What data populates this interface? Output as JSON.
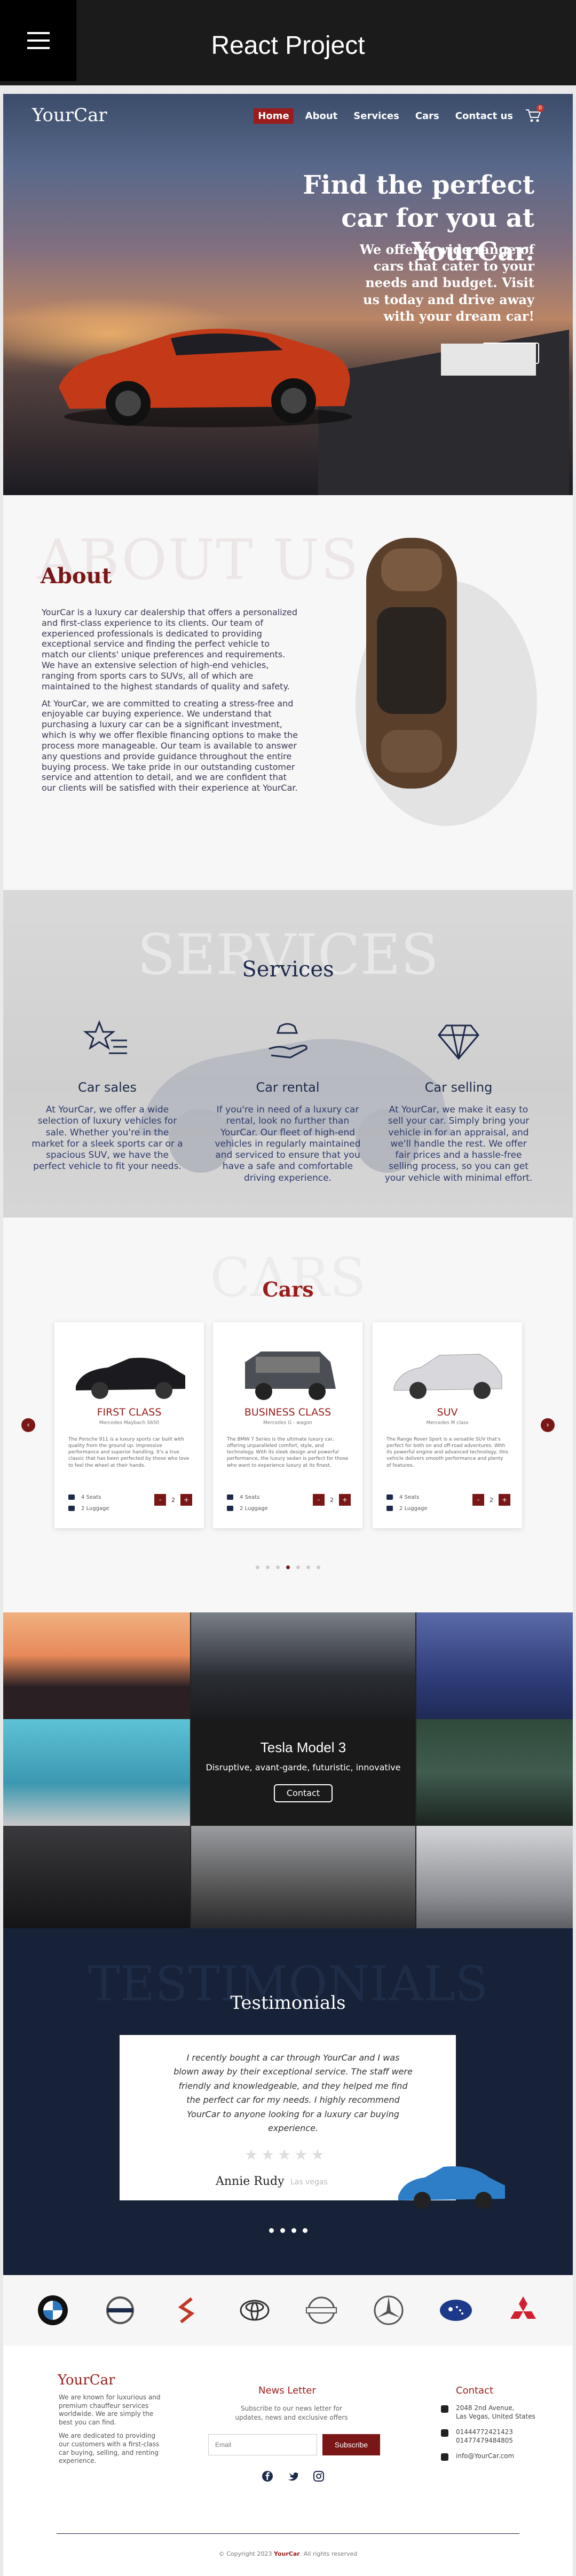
{
  "appbar": {
    "title": "React Project"
  },
  "nav": {
    "logo": "YourCar",
    "links": [
      "Home",
      "About",
      "Services",
      "Cars",
      "Contact us"
    ],
    "cart_count": "0"
  },
  "hero": {
    "heading": "Find the perfect car for you at YourCar.",
    "text": "We offer a wide range of cars that cater to your needs and budget. Visit us today and drive away with your dream car!"
  },
  "about": {
    "ghost": "ABOUT US",
    "title": "About",
    "p1": "YourCar is a luxury car dealership that offers a personalized and first-class experience to its clients. Our team of experienced professionals is dedicated to providing exceptional service and finding the perfect vehicle to match our clients' unique preferences and requirements. We have an extensive selection of high-end vehicles, ranging from sports cars to SUVs, all of which are maintained to the highest standards of quality and safety.",
    "p2": "At YourCar, we are committed to creating a stress-free and enjoyable car buying experience. We understand that purchasing a luxury car can be a significant investment, which is why we offer flexible financing options to make the process more manageable. Our team is available to answer any questions and provide guidance throughout the entire buying process. We take pride in our outstanding customer service and attention to detail, and we are confident that our clients will be satisfied with their experience at YourCar."
  },
  "services": {
    "ghost": "SERVICES",
    "title": "Services",
    "items": [
      {
        "title": "Car sales",
        "icon": "star-list-icon",
        "text": "At YourCar, we offer a wide selection of luxury vehicles for sale. Whether you're in the market for a sleek sports car or a spacious SUV, we have the perfect vehicle to fit your needs."
      },
      {
        "title": "Car rental",
        "icon": "hand-car-icon",
        "text": "If you're in need of a luxury car rental, look no further than YourCar. Our fleet of high-end vehicles in regularly maintained and serviced to ensure that you have a safe and comfortable driving experience."
      },
      {
        "title": "Car selling",
        "icon": "diamond-icon",
        "text": "At YourCar, we make it easy to sell your car. Simply bring your vehicle in for an appraisal, and we'll handle the rest. We offer fair prices and a hassle-free selling process, so you can get your vehicle with minimal effort."
      }
    ]
  },
  "cars": {
    "ghost": "CARS",
    "title": "Cars",
    "items": [
      {
        "title": "FIRST CLASS",
        "sub": "Mercedes Maybach S650",
        "desc": "The Porsche 911 is a luxury sports car built with quality from the ground up. Impressive performance and superior handling. It's a true classic that has been perfected by those who love to feel the wheel at their hands.",
        "seats": "4 Seats",
        "bags": "2 Luggage",
        "qty": "2"
      },
      {
        "title": "BUSINESS CLASS",
        "sub": "Mercedes G - wagon",
        "desc": "The BMW 7 Series is the ultimate luxury car, offering unparalleled comfort, style, and technology. With its sleek design and powerful performance, the luxury sedan is perfect for those who want to experience luxury at its finest.",
        "seats": "4 Seats",
        "bags": "2 Luggage",
        "qty": "2"
      },
      {
        "title": "SUV",
        "sub": "Mercedes M class",
        "desc": "The Range Rover Sport is a versatile SUV that's perfect for both on and off-road adventures. With its powerful engine and advanced technology, this vehicle delivers smooth performance and plenty of features.",
        "seats": "4 Seats",
        "bags": "2 Luggage",
        "qty": "2"
      }
    ]
  },
  "gallery": {
    "feature_title": "Tesla Model 3",
    "feature_sub": "Disruptive, avant-garde, futuristic, innovative",
    "feature_button": "Contact"
  },
  "testimonials": {
    "ghost": "TESTIMONIALS",
    "title": "Testimonials",
    "quote": "I recently bought a car through YourCar and I was blown away by their exceptional service. The staff were friendly and knowledgeable, and they helped me find the perfect car for my needs. I highly recommend YourCar to anyone looking for a luxury car buying experience.",
    "name": "Annie Rudy",
    "location": "Las vegas"
  },
  "brands": [
    "BMW",
    "Volvo",
    "Suzuki",
    "Toyota",
    "Nissan",
    "Mercedes",
    "Subaru",
    "Mitsubishi"
  ],
  "footer": {
    "logo": "YourCar",
    "about1": "We are known for luxurious and premium chauffeur services worldwide. We are simply the best you can find.",
    "about2": "We are dedicated to providing our customers with a first-class car buying, selling, and renting experience.",
    "news_title": "News Letter",
    "news_text": "Subscribe to our news letter for updates, news and exclusive offers",
    "email_placeholder": "Email",
    "subscribe": "Subscribe",
    "contact_title": "Contact",
    "address1": "2048 2nd Avenue,",
    "address2": "Las Vegas, United States",
    "phone1": "01444772421423",
    "phone2": "01477479484805",
    "email": "info@YourCar.com",
    "copy_prefix": "© Copyright 2023",
    "copy_brand": "YourCar",
    "copy_suffix": ". All rights reserved"
  },
  "colors": {
    "accent": "#9b1c1c",
    "navy": "#172238"
  }
}
